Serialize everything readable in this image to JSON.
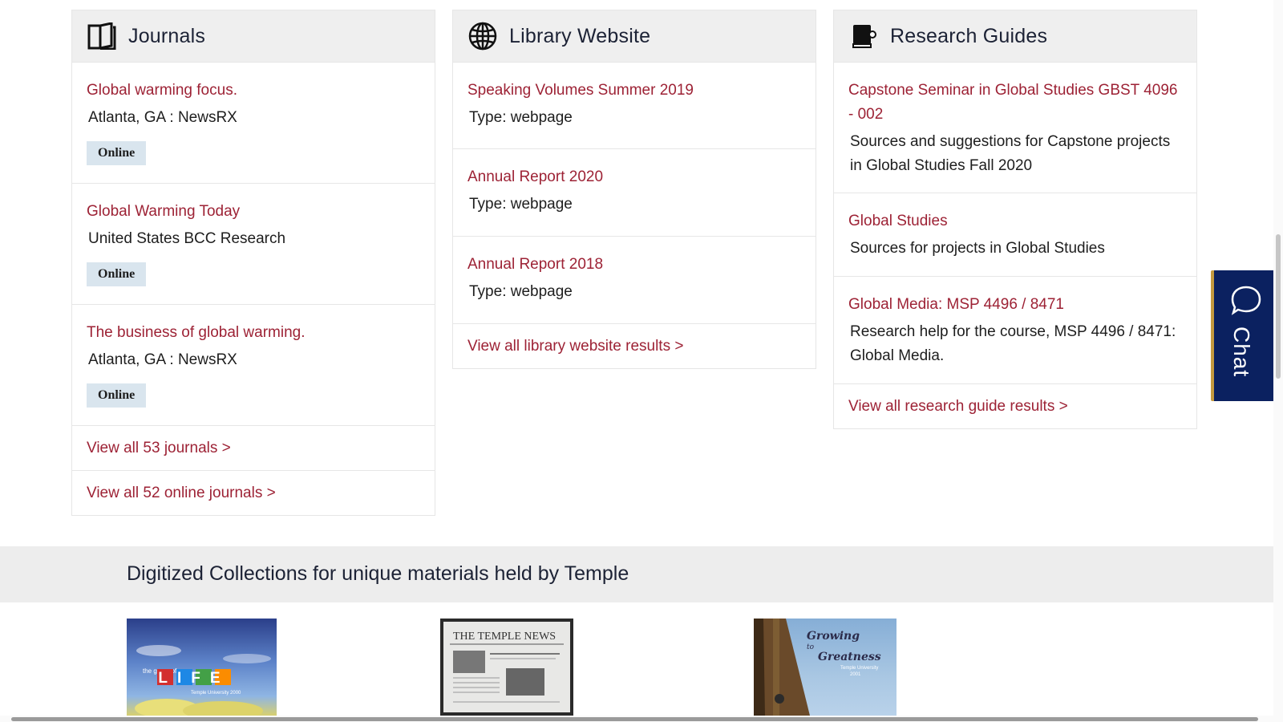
{
  "journals": {
    "title": "Journals",
    "icon": "open-book-icon",
    "items": [
      {
        "title": "Global warming focus.",
        "publisher": "Atlanta, GA : NewsRX",
        "badge": "Online"
      },
      {
        "title": "Global Warming Today",
        "publisher": "United States BCC Research",
        "badge": "Online"
      },
      {
        "title": "The business of global warming.",
        "publisher": "Atlanta, GA : NewsRX",
        "badge": "Online"
      }
    ],
    "view_all": "View all 53 journals >",
    "view_all_online": "View all 52 online journals >"
  },
  "library_website": {
    "title": "Library Website",
    "icon": "globe-icon",
    "items": [
      {
        "title": "Speaking Volumes Summer 2019",
        "type": "Type: webpage"
      },
      {
        "title": "Annual Report 2020",
        "type": "Type: webpage"
      },
      {
        "title": "Annual Report 2018",
        "type": "Type: webpage"
      }
    ],
    "view_all": "View all library website results >"
  },
  "research_guides": {
    "title": "Research Guides",
    "icon": "guide-book-icon",
    "items": [
      {
        "title": "Capstone Seminar in Global Studies GBST 4096 - 002",
        "description": "Sources and suggestions for Capstone projects in Global Studies Fall 2020"
      },
      {
        "title": "Global Studies",
        "description": "Sources for projects in Global Studies"
      },
      {
        "title": "Global Media: MSP 4496 / 8471",
        "description": "Research help for the course, MSP 4496 / 8471: Global Media."
      }
    ],
    "view_all": "View all research guide results >"
  },
  "digitized_collections": {
    "title": "Digitized Collections for unique materials held by Temple",
    "thumbnails": [
      {
        "caption_lines": [
          "the game of",
          "LIFE",
          "Temple University 2000"
        ]
      },
      {
        "caption_lines": [
          "THE TEMPLE NEWS"
        ]
      },
      {
        "caption_lines": [
          "Growing",
          "to",
          "Greatness",
          "Temple University",
          "2001"
        ]
      }
    ]
  },
  "chat": {
    "label": "Chat",
    "icon": "speech-bubble-icon"
  },
  "colors": {
    "link": "#9d2235",
    "heading": "#1c2235",
    "badge_bg": "#d9e5ee",
    "chat_bg": "#0b2160",
    "chat_border": "#c49a3f",
    "header_bg": "#efefef"
  }
}
